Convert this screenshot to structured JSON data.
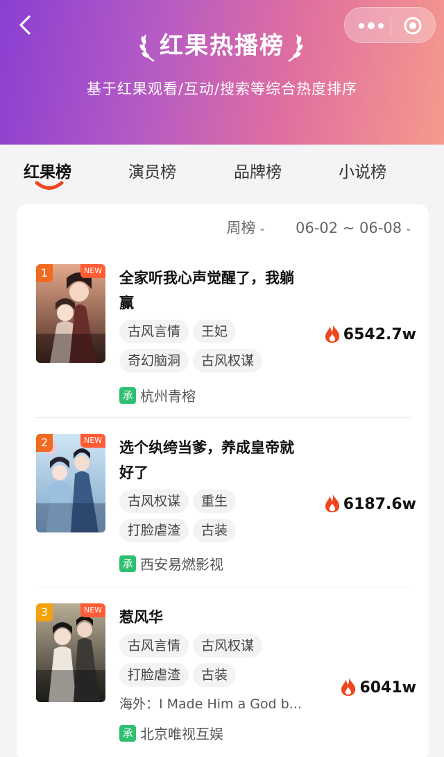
{
  "header": {
    "title": "红果热播榜",
    "subtitle": "基于红果观看/互动/搜索等综合热度排序"
  },
  "tabs": [
    "红果榜",
    "演员榜",
    "品牌榜",
    "小说榜"
  ],
  "filters": {
    "period": "周榜",
    "date_range": "06-02 ~ 06-08"
  },
  "items": [
    {
      "rank": "1",
      "badge": "NEW",
      "title": "全家听我心声觉醒了，我躺赢",
      "tags": [
        "古风言情",
        "王妃",
        "奇幻脑洞",
        "古风权谋"
      ],
      "heat": "6542.7w",
      "studio_badge": "承",
      "studio": "杭州青榕"
    },
    {
      "rank": "2",
      "badge": "NEW",
      "title": "选个纨绔当爹，养成皇帝就好了",
      "tags": [
        "古风权谋",
        "重生",
        "打脸虐渣",
        "古装"
      ],
      "heat": "6187.6w",
      "studio_badge": "承",
      "studio": "西安易燃影视"
    },
    {
      "rank": "3",
      "badge": "NEW",
      "title": "惹风华",
      "tags": [
        "古风言情",
        "古风权谋",
        "打脸虐渣",
        "古装"
      ],
      "abroad": "海外：I Made Him a God b...",
      "heat": "6041w",
      "studio_badge": "承",
      "studio": "北京唯视互娱"
    }
  ],
  "colors": {
    "header_start": "#8a3fd2",
    "header_end": "#f59a8c",
    "accent": "#f0461e",
    "studio_badge": "#2fbf71"
  }
}
